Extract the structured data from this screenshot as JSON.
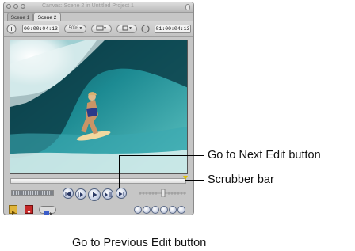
{
  "window": {
    "title": "Canvas: Scene 2 in Untitled Project 1",
    "tabs": [
      "Scene 1",
      "Scene 2"
    ],
    "timecode_current": "00:00:04:13",
    "zoom": "50%",
    "timecode_duration": "01:00:04:13"
  },
  "callouts": {
    "next_edit": "Go to Next Edit button",
    "scrubber": "Scrubber bar",
    "previous_edit": "Go to Previous Edit button"
  },
  "icons": {
    "view_popup": "overlay-popup-icon",
    "format_popup": "view-format-popup-icon",
    "playhead_sync": "playhead-sync-icon",
    "refresh": "loop-icon"
  }
}
